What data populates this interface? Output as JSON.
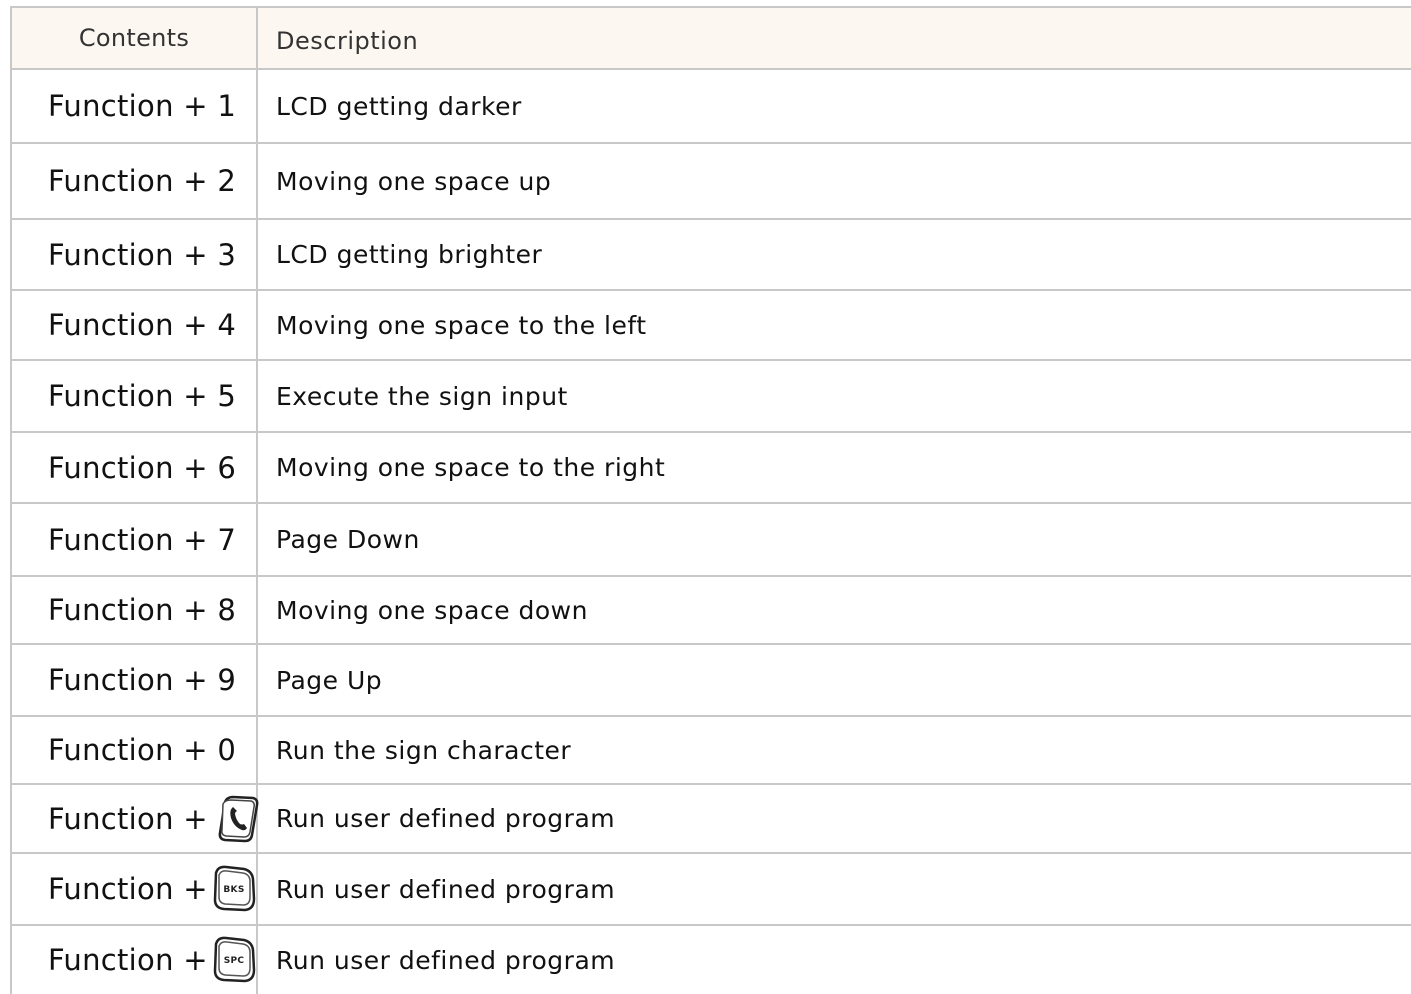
{
  "table": {
    "headers": {
      "contents": "Contents",
      "description": "Description"
    },
    "rows": [
      {
        "key": "Function + 1",
        "description": "LCD getting darker"
      },
      {
        "key": "Function + 2",
        "description": "Moving one space up"
      },
      {
        "key": "Function + 3",
        "description": "LCD getting brighter"
      },
      {
        "key": "Function + 4",
        "description": "Moving one space to the left"
      },
      {
        "key": "Function + 5",
        "description": "Execute the sign input"
      },
      {
        "key": "Function + 6",
        "description": "Moving one space to the right"
      },
      {
        "key": "Function + 7",
        "description": "Page Down"
      },
      {
        "key": "Function + 8",
        "description": "Moving one space down"
      },
      {
        "key": "Function + 9",
        "description": "Page Up"
      },
      {
        "key": "Function + 0",
        "description": "Run the sign character"
      },
      {
        "key": "Function +",
        "key_icon": "phone-key-icon",
        "description": "Run user defined program"
      },
      {
        "key": "Function +",
        "key_icon": "bks-key-icon",
        "key_icon_label": "BKS",
        "description": "Run user defined program"
      },
      {
        "key": "Function +",
        "key_icon": "spc-key-icon",
        "key_icon_label": "SPC",
        "description": "Run user defined program"
      }
    ]
  },
  "colors": {
    "header_background": "#fcf8f1",
    "grid_line": "#c8c8c8",
    "text": "#111111"
  }
}
